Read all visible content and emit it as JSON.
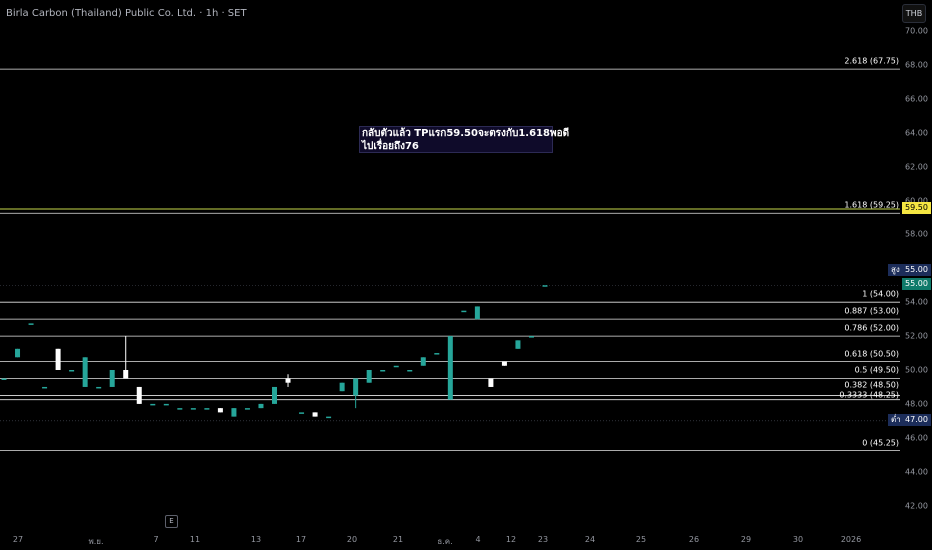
{
  "header": {
    "title": "Birla Carbon (Thailand) Public Co. Ltd. · 1h · SET",
    "currency": "THB"
  },
  "annotation": {
    "line1": "กลับตัวแล้ว TPแรก59.50จะตรงกับ1.618พอดี",
    "line2": "ไปเรื่อยถึง76"
  },
  "markers": {
    "current_price": "59.50",
    "high_label": "สูง",
    "high_value": "55.00",
    "last_value": "55.00",
    "low_label": "ต่ำ",
    "low_value": "47.00",
    "events_icon": "E"
  },
  "chart_data": {
    "type": "candlestick",
    "symbol": "Birla Carbon (Thailand) Public Co. Ltd.",
    "interval": "1h",
    "exchange": "SET",
    "y_ticks": [
      "70.00",
      "68.00",
      "66.00",
      "64.00",
      "62.00",
      "60.00",
      "58.00",
      "56.00",
      "54.00",
      "52.00",
      "50.00",
      "48.00",
      "46.00",
      "44.00",
      "42.00"
    ],
    "x_ticks": [
      "27",
      "พ.ย.",
      "7",
      "11",
      "13",
      "17",
      "20",
      "21",
      "ธ.ค.",
      "4",
      "12",
      "23",
      "24",
      "25",
      "26",
      "29",
      "30",
      "2026"
    ],
    "ylim": [
      41,
      71.5
    ],
    "fib_levels": [
      {
        "label": "2.618 (67.75)",
        "value": 67.75
      },
      {
        "label": "1.618 (59.25)",
        "value": 59.25
      },
      {
        "label": "1 (54.00)",
        "value": 54.0
      },
      {
        "label": "0.887 (53.00)",
        "value": 53.0
      },
      {
        "label": "0.786 (52.00)",
        "value": 52.0
      },
      {
        "label": "0.618 (50.50)",
        "value": 50.5
      },
      {
        "label": "0.5 (49.50)",
        "value": 49.5
      },
      {
        "label": "0.382 (48.50)",
        "value": 48.5
      },
      {
        "label": "0.3333 (48.25)",
        "value": 48.25
      },
      {
        "label": "0 (45.25)",
        "value": 45.25
      }
    ],
    "horizontal_lines": [
      59.5
    ],
    "candles": [
      {
        "o": 49.5,
        "c": 49.5,
        "h": 49.5,
        "l": 49.5
      },
      {
        "o": 50.75,
        "c": 51.25,
        "h": 51.25,
        "l": 50.75
      },
      {
        "o": 52.75,
        "c": 52.75,
        "h": 52.75,
        "l": 52.75
      },
      {
        "o": 49,
        "c": 49,
        "h": 49,
        "l": 49
      },
      {
        "o": 51.25,
        "c": 50,
        "h": 51.25,
        "l": 50
      },
      {
        "o": 50,
        "c": 50,
        "h": 50,
        "l": 50
      },
      {
        "o": 49,
        "c": 50.75,
        "h": 50.75,
        "l": 49
      },
      {
        "o": 49,
        "c": 49,
        "h": 49,
        "l": 49
      },
      {
        "o": 49,
        "c": 50,
        "h": 50,
        "l": 49
      },
      {
        "o": 50,
        "c": 49.5,
        "h": 52,
        "l": 49.5
      },
      {
        "o": 49,
        "c": 48,
        "h": 49,
        "l": 48
      },
      {
        "o": 48,
        "c": 48,
        "h": 48,
        "l": 48
      },
      {
        "o": 48,
        "c": 48,
        "h": 48,
        "l": 48
      },
      {
        "o": 47.75,
        "c": 47.75,
        "h": 47.75,
        "l": 47.75
      },
      {
        "o": 47.75,
        "c": 47.75,
        "h": 47.75,
        "l": 47.75
      },
      {
        "o": 47.75,
        "c": 47.75,
        "h": 47.75,
        "l": 47.75
      },
      {
        "o": 47.75,
        "c": 47.5,
        "h": 47.75,
        "l": 47.5
      },
      {
        "o": 47.25,
        "c": 47.75,
        "h": 47.75,
        "l": 47.25
      },
      {
        "o": 47.75,
        "c": 47.75,
        "h": 47.75,
        "l": 47.75
      },
      {
        "o": 47.75,
        "c": 48,
        "h": 48,
        "l": 47.75
      },
      {
        "o": 48,
        "c": 49,
        "h": 49,
        "l": 48
      },
      {
        "o": 49.5,
        "c": 49.25,
        "h": 49.75,
        "l": 49
      },
      {
        "o": 47.5,
        "c": 47.5,
        "h": 47.5,
        "l": 47.5
      },
      {
        "o": 47.5,
        "c": 47.25,
        "h": 47.5,
        "l": 47.25
      },
      {
        "o": 47.25,
        "c": 47.25,
        "h": 47.25,
        "l": 47.25
      },
      {
        "o": 48.75,
        "c": 49.25,
        "h": 49.25,
        "l": 48.75
      },
      {
        "o": 48.5,
        "c": 49.5,
        "h": 49.5,
        "l": 47.75
      },
      {
        "o": 49.25,
        "c": 50,
        "h": 50,
        "l": 49.25
      },
      {
        "o": 50,
        "c": 50,
        "h": 50,
        "l": 50
      },
      {
        "o": 50.25,
        "c": 50.25,
        "h": 50.25,
        "l": 50.25
      },
      {
        "o": 50,
        "c": 50,
        "h": 50,
        "l": 50
      },
      {
        "o": 50.25,
        "c": 50.75,
        "h": 50.75,
        "l": 50.25
      },
      {
        "o": 51,
        "c": 51,
        "h": 51,
        "l": 51
      },
      {
        "o": 48.25,
        "c": 52,
        "h": 52,
        "l": 48.25
      },
      {
        "o": 53.5,
        "c": 53.5,
        "h": 53.5,
        "l": 53.5
      },
      {
        "o": 53,
        "c": 53.75,
        "h": 53.75,
        "l": 53
      },
      {
        "o": 49.5,
        "c": 49,
        "h": 49.5,
        "l": 49
      },
      {
        "o": 50.5,
        "c": 50.25,
        "h": 50.5,
        "l": 50.25
      },
      {
        "o": 51.25,
        "c": 51.75,
        "h": 51.75,
        "l": 51.25
      },
      {
        "o": 52,
        "c": 52,
        "h": 52,
        "l": 52
      },
      {
        "o": 55,
        "c": 55,
        "h": 55,
        "l": 55
      }
    ],
    "colors": {
      "up": "#26a69a",
      "down": "#ffffff",
      "fib": "#ffffff",
      "target": "#c6d94a"
    }
  }
}
